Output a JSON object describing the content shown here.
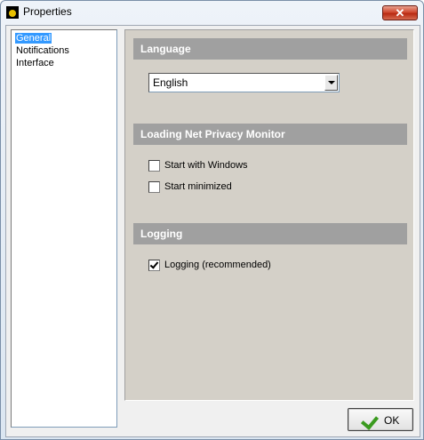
{
  "window": {
    "title": "Properties",
    "close_symbol": "✕"
  },
  "tree": {
    "items": [
      {
        "label": "General",
        "selected": true
      },
      {
        "label": "Notifications",
        "selected": false
      },
      {
        "label": "Interface",
        "selected": false
      }
    ]
  },
  "language": {
    "header": "Language",
    "selected": "English"
  },
  "loading": {
    "header": "Loading Net Privacy Monitor",
    "start_with_windows": {
      "label": "Start with Windows",
      "checked": false
    },
    "start_minimized": {
      "label": "Start minimized",
      "checked": false
    }
  },
  "logging": {
    "header": "Logging",
    "logging": {
      "label": "Logging (recommended)",
      "checked": true
    }
  },
  "footer": {
    "ok_label": "OK"
  },
  "colors": {
    "section_header_bg": "#a0a0a0",
    "selection": "#3399ff",
    "close_button": "#c8412a"
  },
  "icons": {
    "app": "app-icon",
    "close": "close-icon",
    "ok": "checkmark-icon",
    "dropdown": "chevron-down-icon"
  }
}
